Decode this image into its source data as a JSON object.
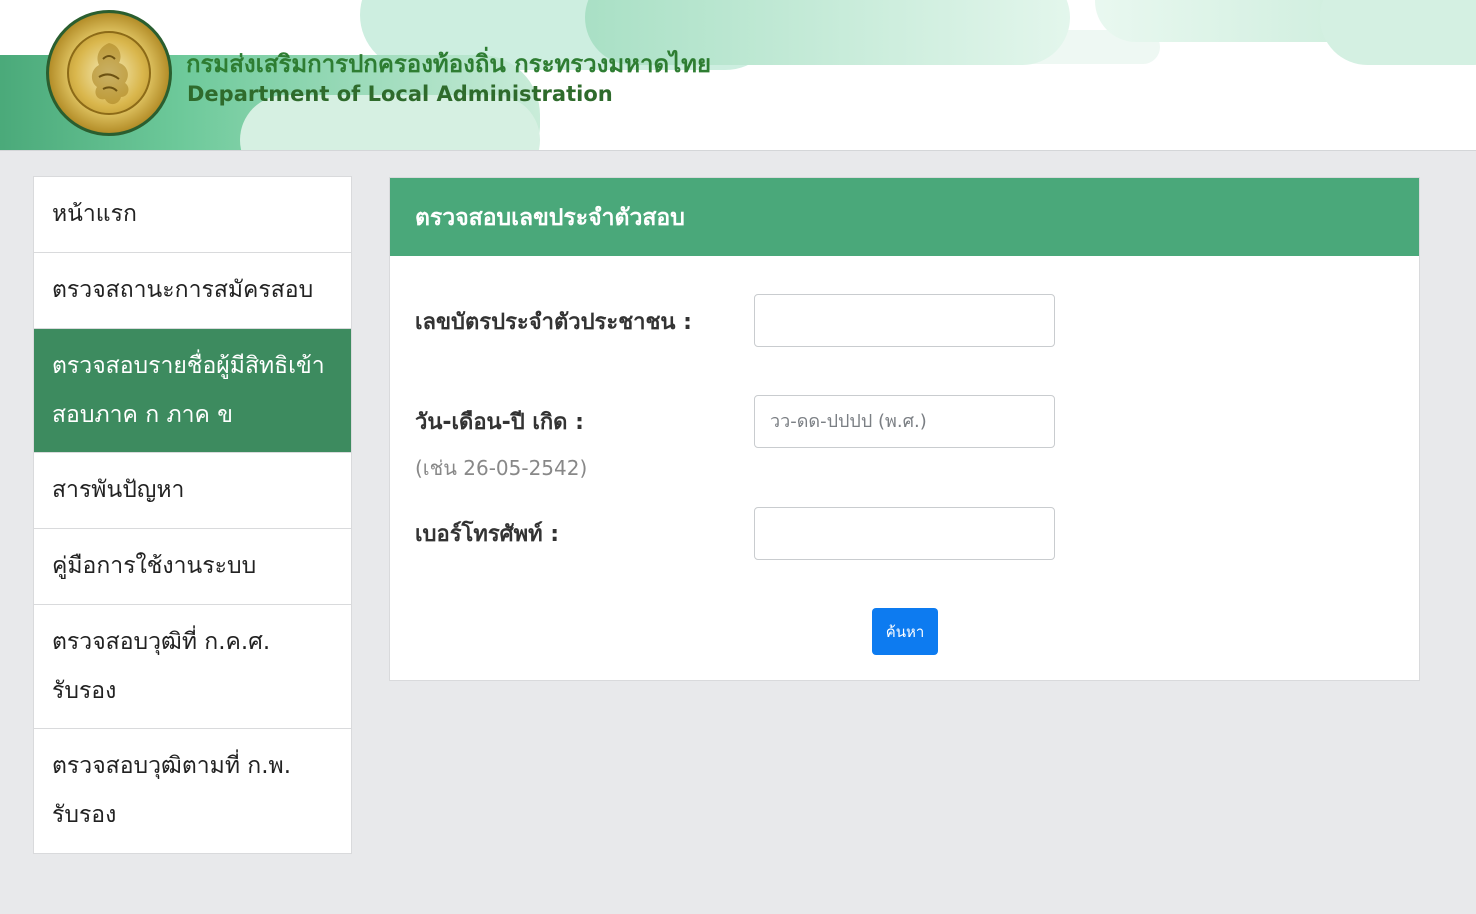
{
  "header": {
    "title_th": "กรมส่งเสริมการปกครองท้องถิ่น กระทรวงมหาดไทย",
    "title_en": "Department of Local Administration"
  },
  "sidebar": {
    "items": [
      {
        "label": "หน้าแรก",
        "active": false
      },
      {
        "label": "ตรวจสถานะการสมัครสอบ",
        "active": false
      },
      {
        "label": "ตรวจสอบรายชื่อผู้มีสิทธิเข้าสอบภาค ก ภาค ข",
        "active": true
      },
      {
        "label": "สารพันปัญหา",
        "active": false
      },
      {
        "label": "คู่มือการใช้งานระบบ",
        "active": false
      },
      {
        "label": "ตรวจสอบวุฒิที่ ก.ค.ศ. รับรอง",
        "active": false
      },
      {
        "label": "ตรวจสอบวุฒิตามที่ ก.พ. รับรอง",
        "active": false
      }
    ]
  },
  "form": {
    "heading": "ตรวจสอบเลขประจำตัวสอบ",
    "id_label": "เลขบัตรประจำตัวประชาชน  :",
    "id_value": "",
    "dob_label": "วัน-เดือน-ปี เกิด  :",
    "dob_hint": "(เช่น  26-05-2542)",
    "dob_placeholder": "วว-ดด-ปปปป (พ.ศ.)",
    "phone_label": "เบอร์โทรศัพท์  :",
    "phone_value": "",
    "search_label": "ค้นหา"
  },
  "colors": {
    "brand_green": "#4aa87a",
    "active_green": "#3d8b5f",
    "button_blue": "#0d7bf0"
  }
}
